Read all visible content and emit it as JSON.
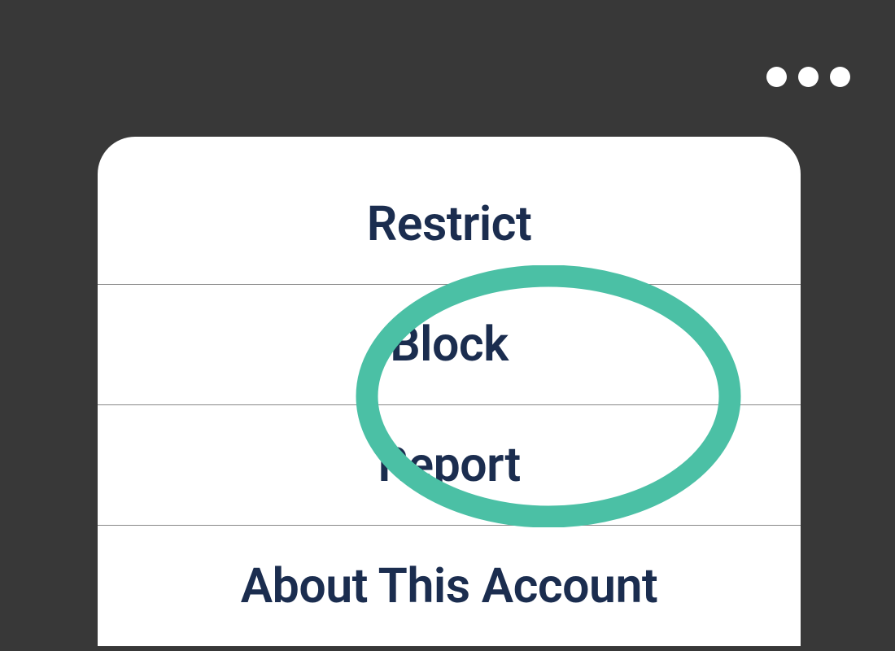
{
  "menu": {
    "items": [
      {
        "label": "Restrict"
      },
      {
        "label": "Block"
      },
      {
        "label": "Report"
      },
      {
        "label": "About This Account"
      }
    ]
  },
  "highlight": {
    "color": "#4bc0a5",
    "targets": [
      "Block",
      "Report"
    ]
  }
}
